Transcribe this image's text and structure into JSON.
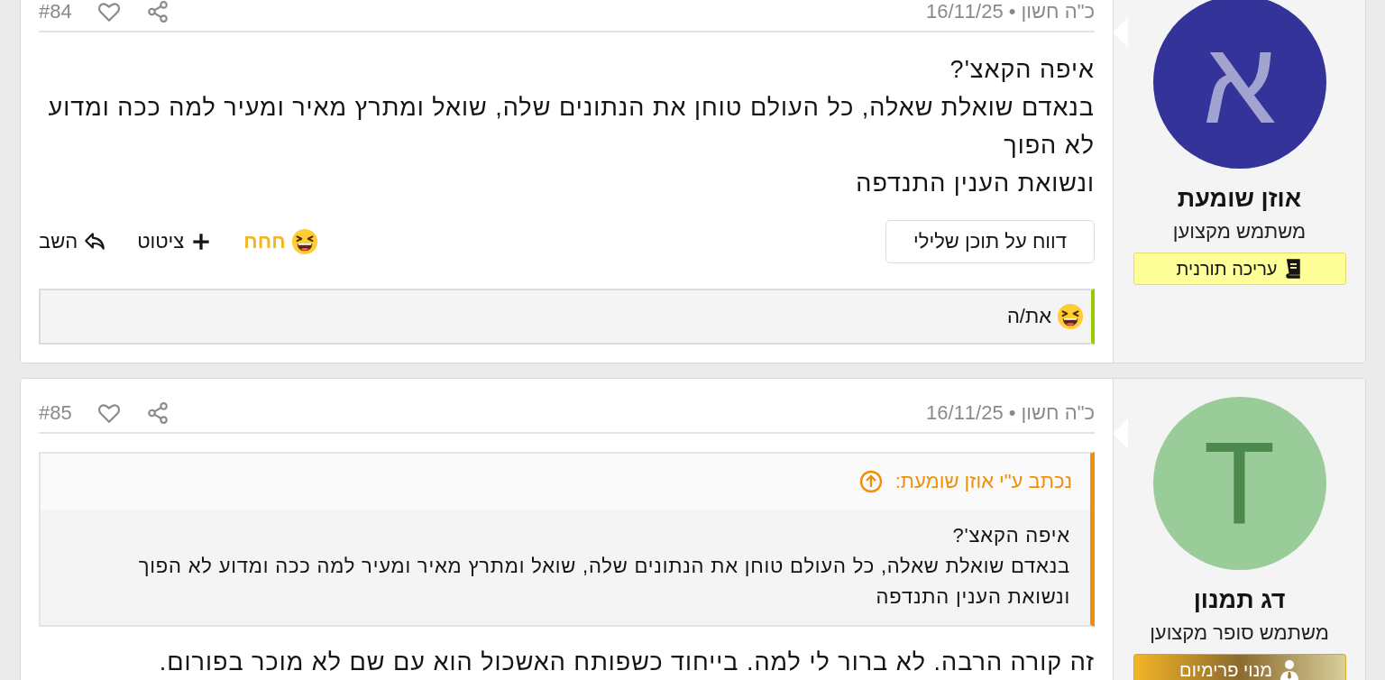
{
  "posts": [
    {
      "number": "#84",
      "date": "כ\"ה חשון • 16/11/25",
      "user": {
        "initial": "א",
        "name": "אוזן שומעת",
        "title": "משתמש מקצוען",
        "color": "#333399"
      },
      "badge": {
        "kind": "editor",
        "label": "עריכה תורנית"
      },
      "body": [
        "איפה הקאצ'?",
        "בנאדם שואלת שאלה, כל העולם טוחן את הנתונים שלה, שואל ומתרץ מאיר ומעיר למה ככה ומדוע לא הפוך",
        "ונשואת הענין התנדפה"
      ],
      "report_button": "דווח על תוכן שלילי",
      "actions": [
        {
          "kind": "reaction",
          "label": "חחח",
          "reacted": true
        },
        {
          "kind": "quote",
          "label": "ציטוט"
        },
        {
          "kind": "reply",
          "label": "השב"
        }
      ],
      "reactions": {
        "label": "את/ה"
      }
    },
    {
      "number": "#85",
      "date": "כ\"ה חשון • 16/11/25",
      "user": {
        "initial": "T",
        "name": "דג תמנון",
        "title": "משתמש סופר מקצוען",
        "color": "#99cc99"
      },
      "badge": {
        "kind": "premium",
        "label": "מנוי פרימיום"
      },
      "quote": {
        "author": "נכתב ע\"י אוזן שומעת:",
        "lines": [
          "איפה הקאצ'?",
          "בנאדם שואלת שאלה, כל העולם טוחן את הנתונים שלה, שואל ומתרץ מאיר ומעיר למה ככה ומדוע לא הפוך",
          "ונשואת הענין התנדפה"
        ]
      },
      "body": [
        "זה קורה הרבה. לא ברור לי למה. בייחוד כשפותח האשכול הוא עם שם לא מוכר בפורום."
      ]
    }
  ]
}
